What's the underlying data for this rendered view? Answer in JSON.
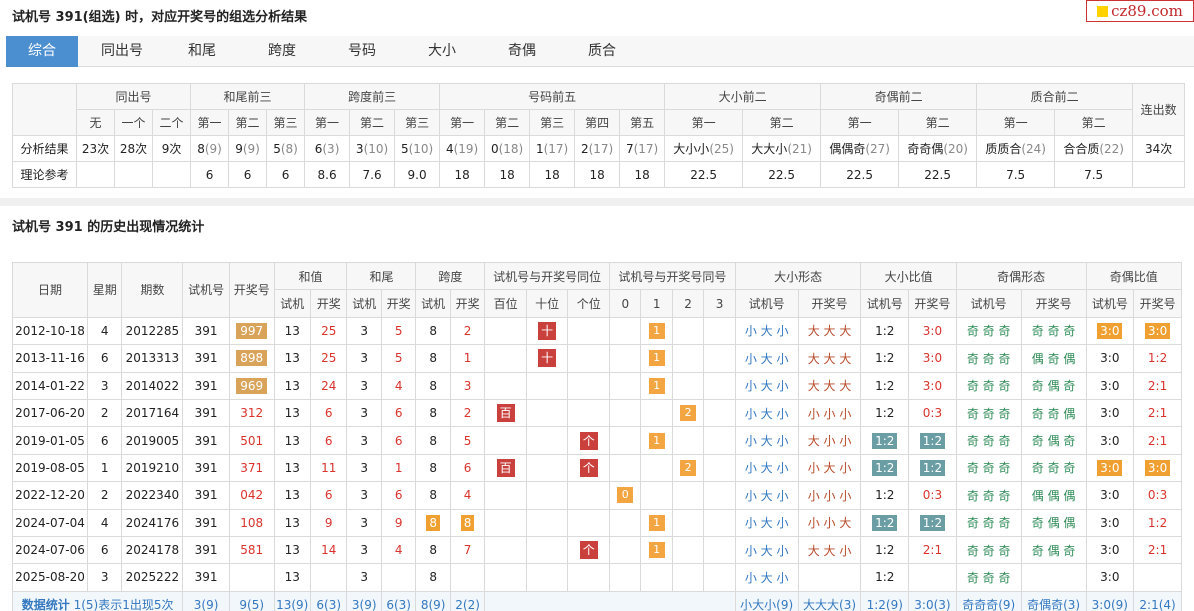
{
  "title1": "试机号 391(组选) 时，对应开奖号的组选分析结果",
  "title2": "试机号 391 的历史出现情况统计",
  "logo": "cz89.com",
  "tabs": [
    "综合",
    "同出号",
    "和尾",
    "跨度",
    "号码",
    "大小",
    "奇偶",
    "质合"
  ],
  "t1": {
    "groups": [
      "同出号",
      "和尾前三",
      "跨度前三",
      "号码前五",
      "大小前二",
      "奇偶前二",
      "质合前二"
    ],
    "lianchu": "连出数",
    "sub": [
      "无",
      "一个",
      "二个",
      "第一",
      "第二",
      "第三",
      "第一",
      "第二",
      "第三",
      "第一",
      "第二",
      "第三",
      "第四",
      "第五",
      "第一",
      "第二",
      "第一",
      "第二",
      "第一",
      "第二"
    ],
    "row1_label": "分析结果",
    "row1": [
      {
        "v": "23次"
      },
      {
        "v": "28次"
      },
      {
        "v": "9次"
      },
      {
        "v": "8",
        "n": "(9)"
      },
      {
        "v": "9",
        "n": "(9)"
      },
      {
        "v": "5",
        "n": "(8)"
      },
      {
        "v": "6",
        "n": "(3)"
      },
      {
        "v": "3",
        "n": "(10)"
      },
      {
        "v": "5",
        "n": "(10)"
      },
      {
        "v": "4",
        "n": "(19)"
      },
      {
        "v": "0",
        "n": "(18)"
      },
      {
        "v": "1",
        "n": "(17)"
      },
      {
        "v": "2",
        "n": "(17)"
      },
      {
        "v": "7",
        "n": "(17)"
      },
      {
        "v": "大小小",
        "n": "(25)"
      },
      {
        "v": "大大小",
        "n": "(21)"
      },
      {
        "v": "偶偶奇",
        "n": "(27)"
      },
      {
        "v": "奇奇偶",
        "n": "(20)"
      },
      {
        "v": "质质合",
        "n": "(24)"
      },
      {
        "v": "合合质",
        "n": "(22)"
      },
      {
        "v": "34次"
      }
    ],
    "row2_label": "理论参考",
    "row2": [
      "",
      "",
      "",
      "6",
      "6",
      "6",
      "8.6",
      "7.6",
      "9.0",
      "18",
      "18",
      "18",
      "18",
      "18",
      "22.5",
      "22.5",
      "22.5",
      "22.5",
      "7.5",
      "7.5",
      ""
    ]
  },
  "t2": {
    "h1": {
      "date": "日期",
      "week": "星期",
      "issue": "期数",
      "test": "试机号",
      "draw": "开奖号",
      "sum": "和值",
      "tail": "和尾",
      "span": "跨度",
      "same_pos": "试机号与开奖号同位",
      "same_num": "试机号与开奖号同号",
      "bs_form": "大小形态",
      "bs_ratio": "大小比值",
      "oe_form": "奇偶形态",
      "oe_ratio": "奇偶比值"
    },
    "h2": {
      "test": "试机",
      "draw": "开奖",
      "bai": "百位",
      "shi": "十位",
      "ge": "个位",
      "n0": "0",
      "n1": "1",
      "n2": "2",
      "n3": "3",
      "test_num": "试机号",
      "draw_num": "开奖号"
    },
    "rows": [
      {
        "date": "2012-10-18",
        "week": "4",
        "issue": "2012285",
        "test": "391",
        "draw": "997",
        "draw_hl": true,
        "s1": "13",
        "s2": "25",
        "t1": "3",
        "t2": "5",
        "p1": "8",
        "p2": "2",
        "bai": "",
        "shi": "十",
        "ge": "",
        "n0": "",
        "n1": "1",
        "n2": "",
        "n3": "",
        "bs1": "小 大 小",
        "bs2": "大 大 大",
        "br1": "1:2",
        "br2": "3:0",
        "oe1": "奇 奇 奇",
        "oe2": "奇 奇 奇",
        "or1": "3:0",
        "or1hl": true,
        "or2": "3:0",
        "or2hl": true
      },
      {
        "date": "2013-11-16",
        "week": "6",
        "issue": "2013313",
        "test": "391",
        "draw": "898",
        "draw_hl": true,
        "s1": "13",
        "s2": "25",
        "t1": "3",
        "t2": "5",
        "p1": "8",
        "p2": "1",
        "bai": "",
        "shi": "十",
        "ge": "",
        "n0": "",
        "n1": "1",
        "n2": "",
        "n3": "",
        "bs1": "小 大 小",
        "bs2": "大 大 大",
        "br1": "1:2",
        "br2": "3:0",
        "oe1": "奇 奇 奇",
        "oe2": "偶 奇 偶",
        "or1": "3:0",
        "or2": "1:2"
      },
      {
        "date": "2014-01-22",
        "week": "3",
        "issue": "2014022",
        "test": "391",
        "draw": "969",
        "draw_hl": true,
        "s1": "13",
        "s2": "24",
        "t1": "3",
        "t2": "4",
        "p1": "8",
        "p2": "3",
        "bai": "",
        "shi": "",
        "ge": "",
        "n0": "",
        "n1": "1",
        "n2": "",
        "n3": "",
        "bs1": "小 大 小",
        "bs2": "大 大 大",
        "br1": "1:2",
        "br2": "3:0",
        "oe1": "奇 奇 奇",
        "oe2": "奇 偶 奇",
        "or1": "3:0",
        "or2": "2:1"
      },
      {
        "date": "2017-06-20",
        "week": "2",
        "issue": "2017164",
        "test": "391",
        "draw": "312",
        "s1": "13",
        "s2": "6",
        "t1": "3",
        "t2": "6",
        "p1": "8",
        "p2": "2",
        "bai": "百",
        "shi": "",
        "ge": "",
        "n0": "",
        "n1": "",
        "n2": "2",
        "n3": "",
        "bs1": "小 大 小",
        "bs2": "小 小 小",
        "br1": "1:2",
        "br2": "0:3",
        "oe1": "奇 奇 奇",
        "oe2": "奇 奇 偶",
        "or1": "3:0",
        "or2": "2:1"
      },
      {
        "date": "2019-01-05",
        "week": "6",
        "issue": "2019005",
        "test": "391",
        "draw": "501",
        "s1": "13",
        "s2": "6",
        "t1": "3",
        "t2": "6",
        "p1": "8",
        "p2": "5",
        "bai": "",
        "shi": "",
        "ge": "个",
        "n0": "",
        "n1": "1",
        "n2": "",
        "n3": "",
        "bs1": "小 大 小",
        "bs2": "大 小 小",
        "br1": "1:2",
        "br1hl": true,
        "br2": "1:2",
        "br2hl": true,
        "oe1": "奇 奇 奇",
        "oe2": "奇 偶 奇",
        "or1": "3:0",
        "or2": "2:1"
      },
      {
        "date": "2019-08-05",
        "week": "1",
        "issue": "2019210",
        "test": "391",
        "draw": "371",
        "s1": "13",
        "s2": "11",
        "t1": "3",
        "t2": "1",
        "p1": "8",
        "p2": "6",
        "bai": "百",
        "shi": "",
        "ge": "个",
        "n0": "",
        "n1": "",
        "n2": "2",
        "n3": "",
        "bs1": "小 大 小",
        "bs2": "小 大 小",
        "br1": "1:2",
        "br1hl": true,
        "br2": "1:2",
        "br2hl": true,
        "oe1": "奇 奇 奇",
        "oe2": "奇 奇 奇",
        "or1": "3:0",
        "or1hl": true,
        "or2": "3:0",
        "or2hl": true
      },
      {
        "date": "2022-12-20",
        "week": "2",
        "issue": "2022340",
        "test": "391",
        "draw": "042",
        "s1": "13",
        "s2": "6",
        "t1": "3",
        "t2": "6",
        "p1": "8",
        "p2": "4",
        "bai": "",
        "shi": "",
        "ge": "",
        "n0": "0",
        "n1": "",
        "n2": "",
        "n3": "",
        "bs1": "小 大 小",
        "bs2": "小 小 小",
        "br1": "1:2",
        "br2": "0:3",
        "oe1": "奇 奇 奇",
        "oe2": "偶 偶 偶",
        "or1": "3:0",
        "or2": "0:3"
      },
      {
        "date": "2024-07-04",
        "week": "4",
        "issue": "2024176",
        "test": "391",
        "draw": "108",
        "s1": "13",
        "s2": "9",
        "t1": "3",
        "t2": "9",
        "p1": "8",
        "p1hl": true,
        "p2": "8",
        "p2hl": true,
        "bai": "",
        "shi": "",
        "ge": "",
        "n0": "",
        "n1": "1",
        "n2": "",
        "n3": "",
        "bs1": "小 大 小",
        "bs2": "小 小 大",
        "br1": "1:2",
        "br1hl": true,
        "br2": "1:2",
        "br2hl": true,
        "oe1": "奇 奇 奇",
        "oe2": "奇 偶 偶",
        "or1": "3:0",
        "or2": "1:2"
      },
      {
        "date": "2024-07-06",
        "week": "6",
        "issue": "2024178",
        "test": "391",
        "draw": "581",
        "s1": "13",
        "s2": "14",
        "t1": "3",
        "t2": "4",
        "p1": "8",
        "p2": "7",
        "bai": "",
        "shi": "",
        "ge": "个",
        "n0": "",
        "n1": "1",
        "n2": "",
        "n3": "",
        "bs1": "小 大 小",
        "bs2": "大 大 小",
        "br1": "1:2",
        "br2": "2:1",
        "oe1": "奇 奇 奇",
        "oe2": "奇 偶 奇",
        "or1": "3:0",
        "or2": "2:1"
      },
      {
        "date": "2025-08-20",
        "week": "3",
        "issue": "2025222",
        "test": "391",
        "draw": "",
        "s1": "13",
        "s2": "",
        "t1": "3",
        "t2": "",
        "p1": "8",
        "p2": "",
        "bai": "",
        "shi": "",
        "ge": "",
        "n0": "",
        "n1": "",
        "n2": "",
        "n3": "",
        "bs1": "小 大 小",
        "bs2": "",
        "br1": "1:2",
        "br2": "",
        "oe1": "奇 奇 奇",
        "oe2": "",
        "or1": "3:0",
        "or2": ""
      }
    ],
    "foot": {
      "label": "数据统计",
      "note": "1(5)表示1出现5次",
      "test": "3(9)",
      "draw": "9(5)",
      "s1": "13(9)",
      "s2": "6(3)",
      "t1": "3(9)",
      "t2": "6(3)",
      "p1": "8(9)",
      "p2": "2(2)",
      "bs1": "小大小(9)",
      "bs2": "大大大(3)",
      "br1": "1:2(9)",
      "br2": "3:0(3)",
      "oe1": "奇奇奇(9)",
      "oe2": "奇偶奇(3)",
      "or1": "3:0(9)",
      "or2": "2:1(4)"
    }
  }
}
